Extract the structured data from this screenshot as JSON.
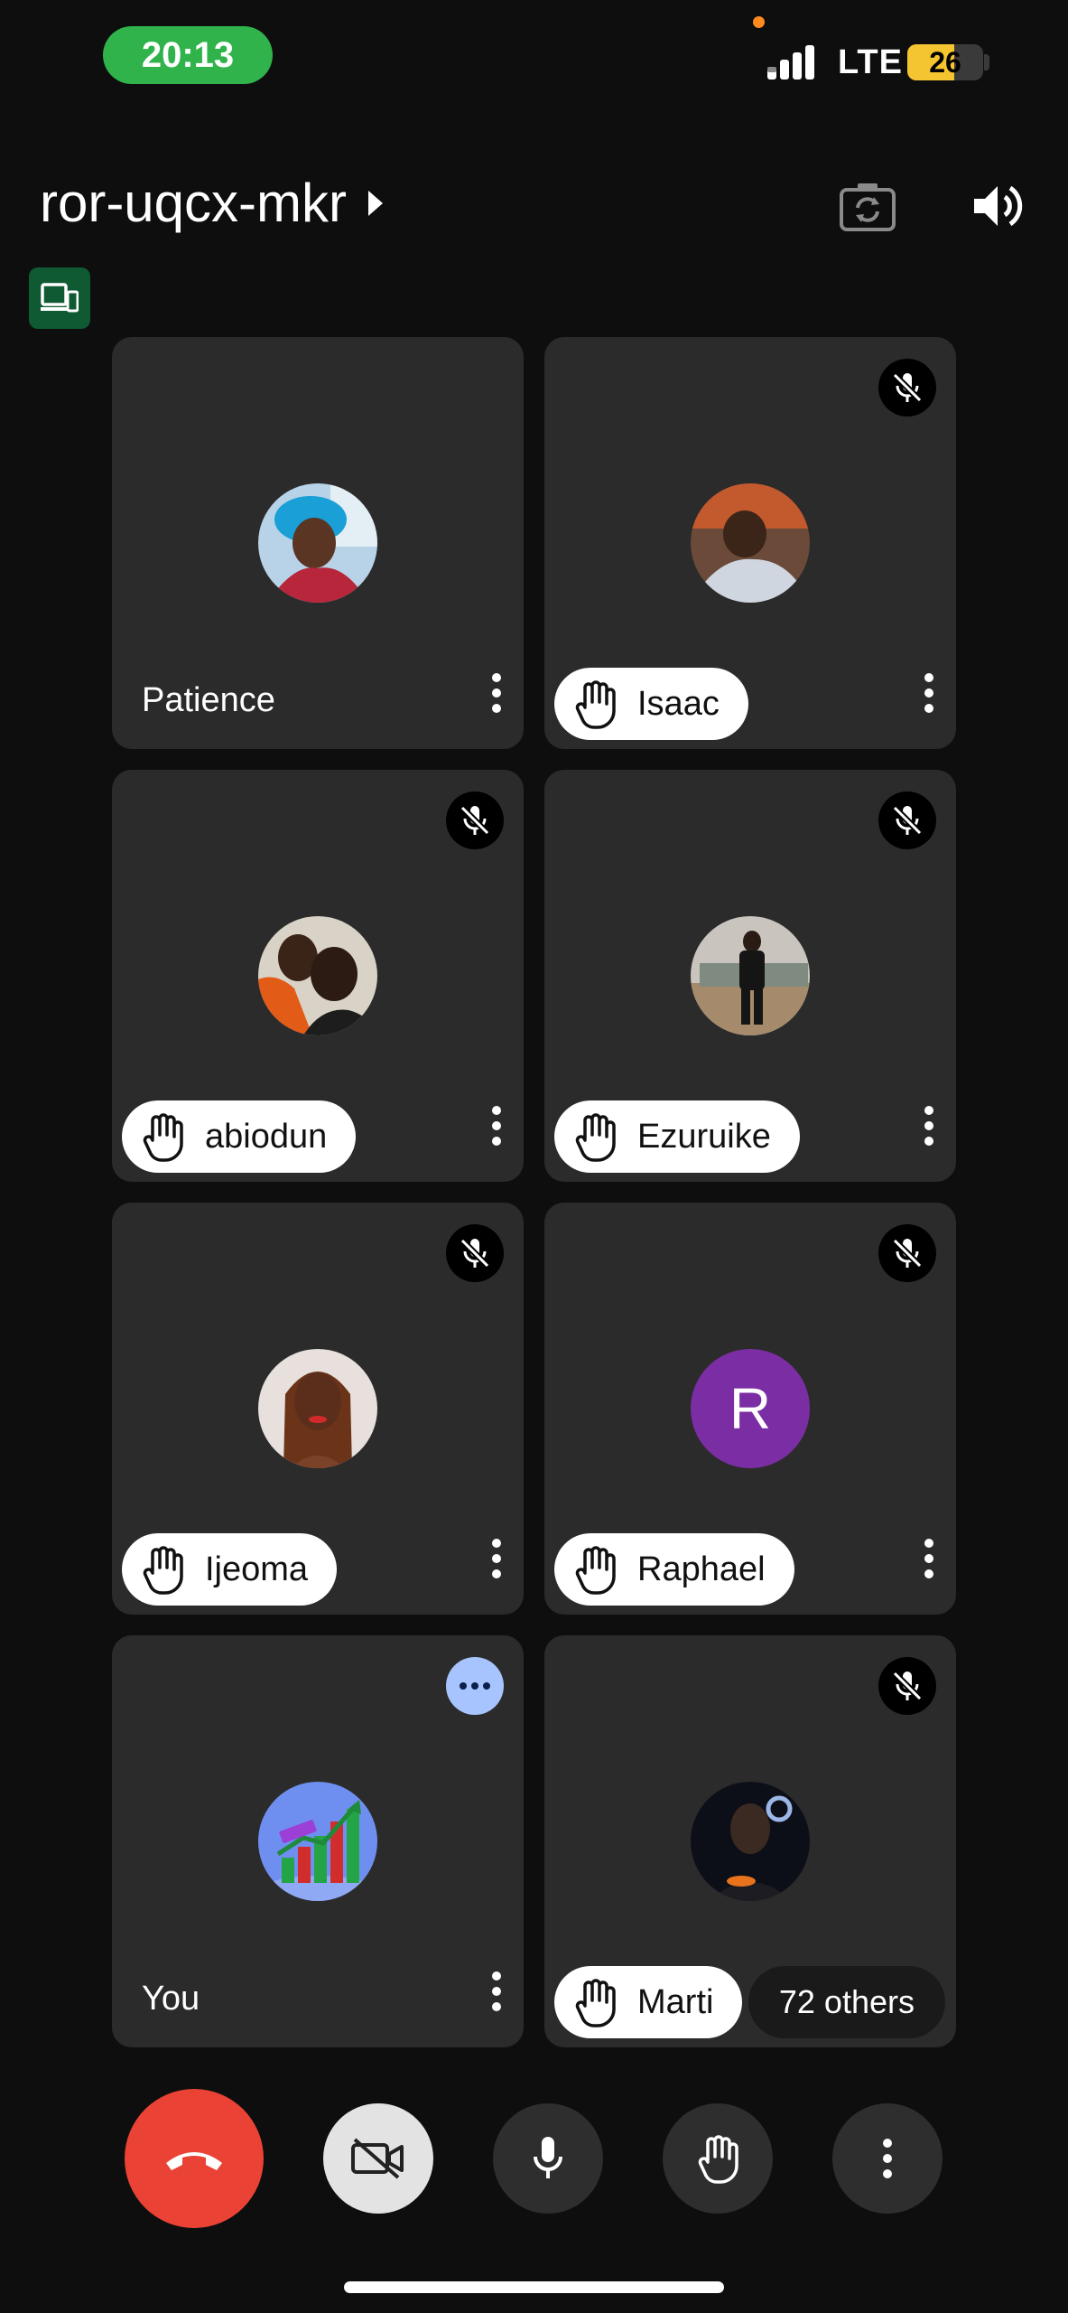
{
  "status_bar": {
    "time": "20:13",
    "network": "LTE",
    "battery": "26",
    "battery_level_percent": 26,
    "colors": {
      "time_pill": "#2fb34a",
      "battery": "#f4c530"
    }
  },
  "header": {
    "meeting_code": "ror-uqcx-mkr",
    "icons": [
      "switch-camera-icon",
      "speaker-icon",
      "device-badge-icon"
    ]
  },
  "participants": [
    {
      "name": "Patience",
      "hand_raised": false,
      "muted": false
    },
    {
      "name": "Isaac",
      "hand_raised": true,
      "muted": true
    },
    {
      "name": "abiodun",
      "hand_raised": true,
      "muted": true
    },
    {
      "name": "Ezuruike",
      "hand_raised": true,
      "muted": true
    },
    {
      "name": "Ijeoma",
      "hand_raised": true,
      "muted": true
    },
    {
      "name": "Raphael",
      "hand_raised": true,
      "muted": true,
      "avatar_letter": "R"
    },
    {
      "name": "You",
      "hand_raised": false,
      "muted": false
    },
    {
      "name": "Marti",
      "hand_raised": true,
      "muted": true
    }
  ],
  "others_label": "72 others",
  "controls": [
    "end-call",
    "camera-off",
    "microphone",
    "raise-hand",
    "more-options"
  ],
  "colors": {
    "end_call": "#ea4335",
    "tile": "#2b2b2b",
    "raphael_avatar": "#7b2ea3",
    "you_more": "#a7c4ff"
  }
}
